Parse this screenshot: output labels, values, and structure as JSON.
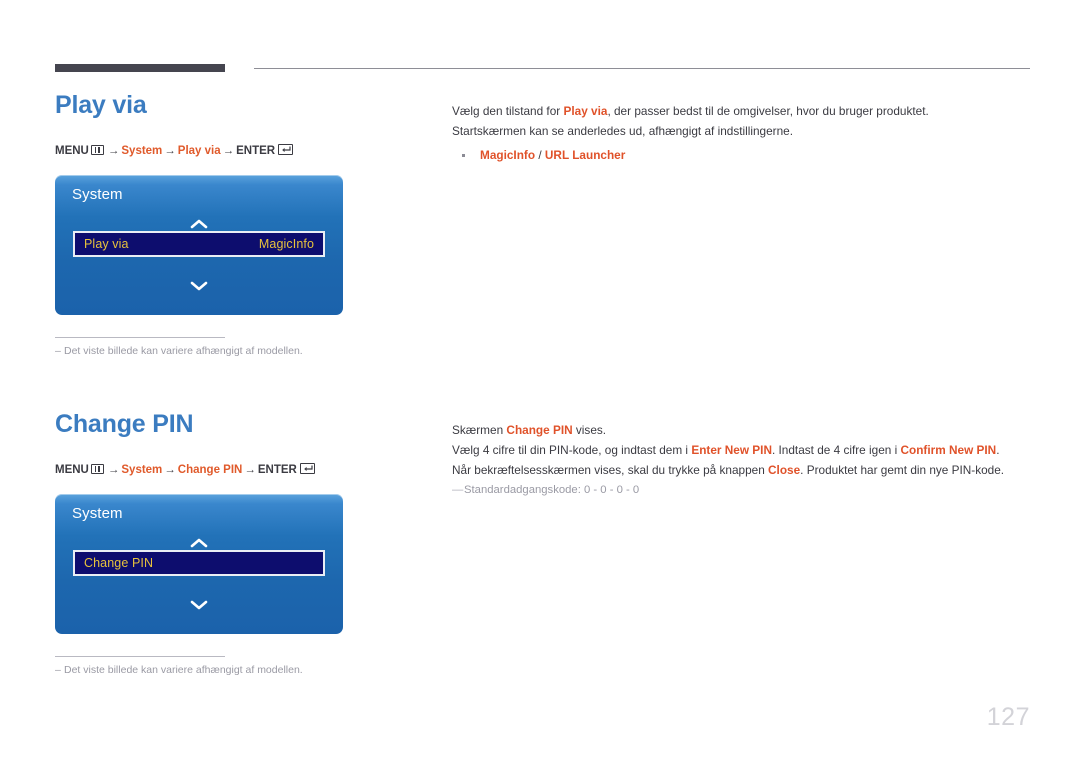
{
  "page": {
    "number": "127"
  },
  "sections": [
    {
      "heading": "Play via",
      "breadcrumb": {
        "menu_label": "MENU",
        "menu_icon": "menu-grid-icon",
        "arrow": "→",
        "crumb1": "System",
        "crumb2": "Play via",
        "enter_label": "ENTER",
        "enter_icon": "enter-return-icon"
      },
      "osd": {
        "title": "System",
        "up_icon": "chevron-up-icon",
        "down_icon": "chevron-down-icon",
        "row_label": "Play via",
        "row_value": "MagicInfo"
      },
      "footnote": {
        "dash": "–",
        "text": "Det viste billede kan variere afhængigt af modellen."
      },
      "body": {
        "line1_a": "Vælg den tilstand for ",
        "line1_b": "Play via",
        "line1_c": ", der passer bedst til de omgivelser, hvor du bruger produktet.",
        "line2": "Startskærmen kan se anderledes ud, afhængigt af indstillingerne.",
        "bullet_a": "MagicInfo",
        "bullet_sep": " / ",
        "bullet_b": "URL Launcher"
      }
    },
    {
      "heading": "Change PIN",
      "breadcrumb": {
        "menu_label": "MENU",
        "menu_icon": "menu-grid-icon",
        "arrow": "→",
        "crumb1": "System",
        "crumb2": "Change PIN",
        "enter_label": "ENTER",
        "enter_icon": "enter-return-icon"
      },
      "osd": {
        "title": "System",
        "up_icon": "chevron-up-icon",
        "down_icon": "chevron-down-icon",
        "row_label": "Change PIN",
        "row_value": ""
      },
      "footnote": {
        "dash": "–",
        "text": "Det viste billede kan variere afhængigt af modellen."
      },
      "body": {
        "line1_a": "Skærmen ",
        "line1_b": "Change PIN",
        "line1_c": " vises.",
        "line2_a": "Vælg 4 cifre til din PIN-kode, og indtast dem i ",
        "line2_b": "Enter New PIN",
        "line2_c": ". Indtast de 4 cifre igen i ",
        "line2_d": "Confirm New PIN",
        "line2_e": ".",
        "line3_a": "Når bekræftelsesskærmen vises, skal du trykke på knappen ",
        "line3_b": "Close",
        "line3_c": ". Produktet har gemt din nye PIN-kode.",
        "note_dash": "—",
        "note": "Standardadgangskode: 0 - 0 - 0 - 0"
      }
    }
  ]
}
